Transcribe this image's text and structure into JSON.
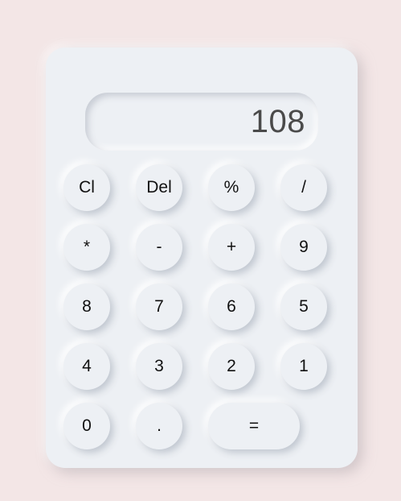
{
  "display": {
    "value": "108"
  },
  "keys": {
    "clear": "Cl",
    "delete": "Del",
    "percent": "%",
    "divide": "/",
    "multiply": "*",
    "subtract": "-",
    "add": "+",
    "nine": "9",
    "eight": "8",
    "seven": "7",
    "six": "6",
    "five": "5",
    "four": "4",
    "three": "3",
    "two": "2",
    "one": "1",
    "zero": "0",
    "decimal": ".",
    "equals": "="
  },
  "colors": {
    "page_background": "#f3e6e6",
    "calculator_surface": "#edf0f4",
    "display_text": "#4a4a4a",
    "key_text": "#111111"
  }
}
